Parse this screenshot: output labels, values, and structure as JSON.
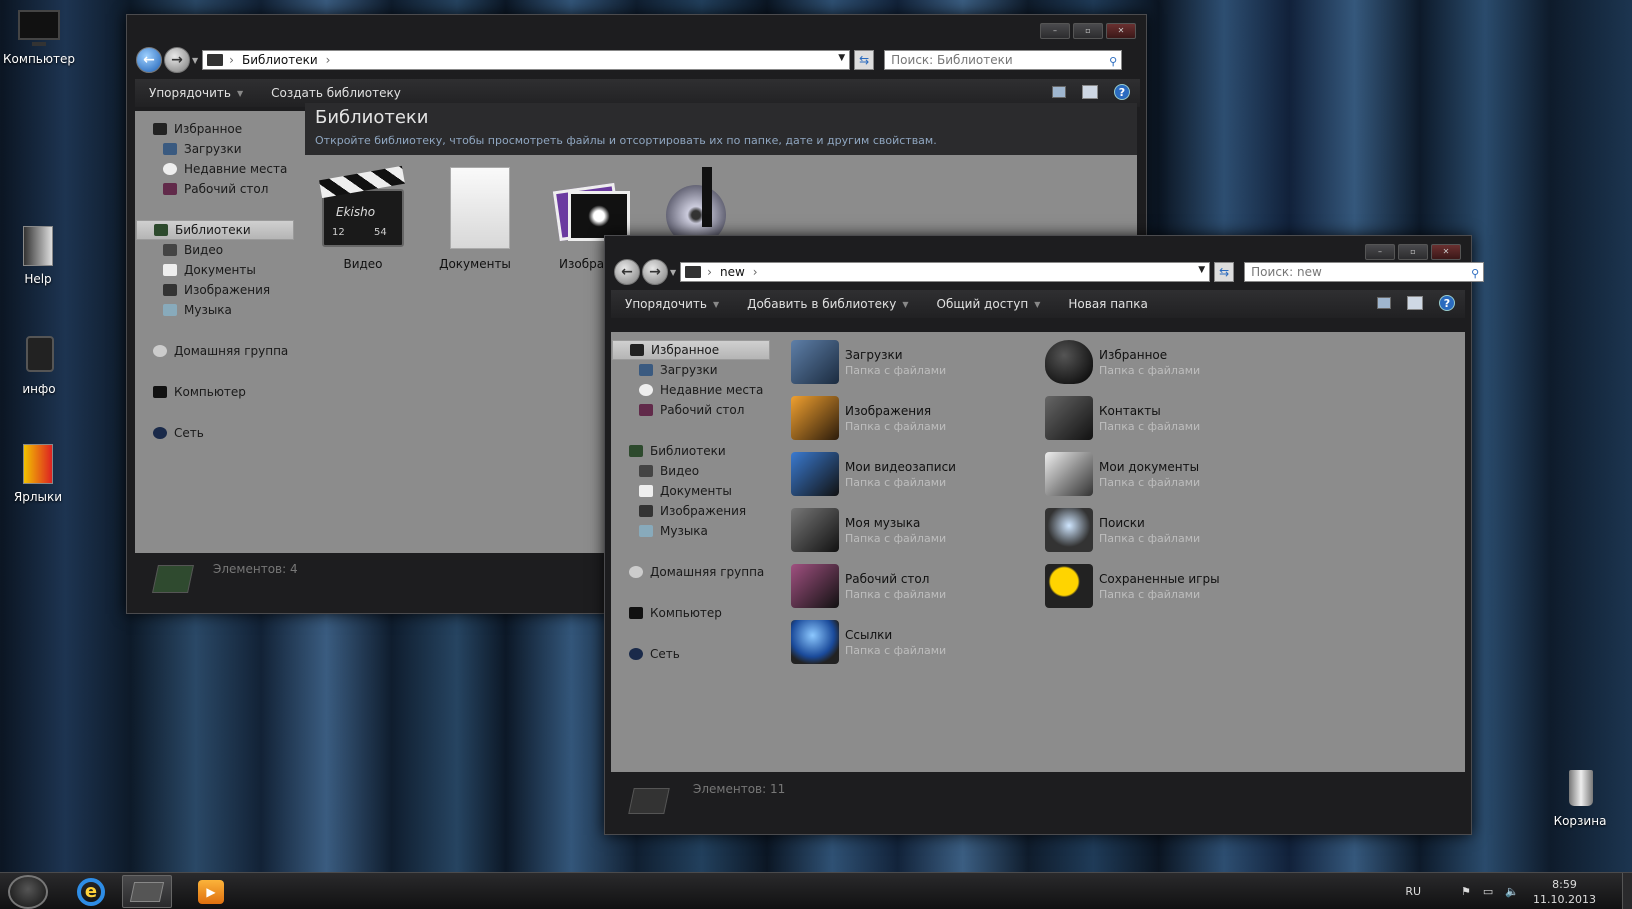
{
  "desktop": {
    "icons": [
      {
        "label": "Компьютер"
      },
      {
        "label": "Help"
      },
      {
        "label": "инфо"
      },
      {
        "label": "Ярлыки"
      },
      {
        "label": "Корзина"
      }
    ]
  },
  "win1": {
    "path": "Библиотеки",
    "search_placeholder": "Поиск: Библиотеки",
    "toolbar": {
      "organize": "Упорядочить",
      "create_library": "Создать библиотеку"
    },
    "nav": {
      "favorites": "Избранное",
      "fav_items": [
        "Загрузки",
        "Недавние места",
        "Рабочий стол"
      ],
      "libraries": "Библиотеки",
      "lib_items": [
        "Видео",
        "Документы",
        "Изображения",
        "Музыка"
      ],
      "homegroup": "Домашняя группа",
      "computer": "Компьютер",
      "network": "Сеть"
    },
    "header_title": "Библиотеки",
    "header_sub": "Откройте библиотеку, чтобы просмотреть файлы и отсортировать их по папке, дате и другим свойствам.",
    "tiles": [
      "Видео",
      "Документы",
      "Изображ"
    ],
    "status": "Элементов: 4",
    "clapper_text": "Ekisho",
    "clapper_take": "12",
    "clapper_scene": "54"
  },
  "win2": {
    "path": "new",
    "search_placeholder": "Поиск: new",
    "toolbar": {
      "organize": "Упорядочить",
      "add_library": "Добавить в библиотеку",
      "share": "Общий доступ",
      "new_folder": "Новая папка"
    },
    "nav": {
      "favorites": "Избранное",
      "fav_items": [
        "Загрузки",
        "Недавние места",
        "Рабочий стол"
      ],
      "libraries": "Библиотеки",
      "lib_items": [
        "Видео",
        "Документы",
        "Изображения",
        "Музыка"
      ],
      "homegroup": "Домашняя группа",
      "computer": "Компьютер",
      "network": "Сеть"
    },
    "folder_type": "Папка с файлами",
    "folders_left": [
      "Загрузки",
      "Изображения",
      "Мои видеозаписи",
      "Моя музыка",
      "Рабочий стол",
      "Ссылки"
    ],
    "folders_right": [
      "Избранное",
      "Контакты",
      "Мои документы",
      "Поиски",
      "Сохраненные игры"
    ],
    "status": "Элементов: 11"
  },
  "taskbar": {
    "lang": "RU",
    "time": "8:59",
    "date": "11.10.2013"
  },
  "colors": {
    "accent": "#2a6bbf",
    "content_bg": "#8c8c8c",
    "chrome": "#1d1d1f"
  }
}
